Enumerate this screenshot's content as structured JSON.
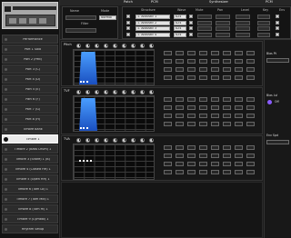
{
  "sidebar": {
    "items": [
      {
        "label": "Performance",
        "selected": false
      },
      {
        "label": "Part 1 Solo",
        "selected": false
      },
      {
        "label": "Part 2 (Ped)",
        "selected": false
      },
      {
        "label": "Part 3 (C)",
        "selected": false
      },
      {
        "label": "Part 4 (D)",
        "selected": false
      },
      {
        "label": "Part 5 (E)",
        "selected": false
      },
      {
        "label": "Part 6 (F)",
        "selected": false
      },
      {
        "label": "Part 7 (G)",
        "selected": false
      },
      {
        "label": "Part 8 (H)",
        "selected": false
      },
      {
        "label": "Timbre Bank",
        "selected": false
      },
      {
        "label": "Timbre 1",
        "selected": true
      },
      {
        "label": "Timbre 2 (Bass Drum) 1",
        "selected": false
      },
      {
        "label": "Timbre 3 (Snare) 1 (B)",
        "selected": false
      },
      {
        "label": "Timbre 4 (Closed HH) 1",
        "selected": false
      },
      {
        "label": "Timbre 5 (Open HH) 1",
        "selected": false
      },
      {
        "label": "Timbre 6 (Tom Lo) 1",
        "selected": false
      },
      {
        "label": "Timbre 7 (Tom Mid) 1",
        "selected": false
      },
      {
        "label": "Timbre 8 (Tom Hi) 1",
        "selected": false
      },
      {
        "label": "Timbre 9 (Cymbal) 1",
        "selected": false
      },
      {
        "label": "Rhythm Setup",
        "selected": false
      }
    ]
  },
  "header": {
    "tabs": [
      "PCM",
      "Synthesizer",
      "PCM"
    ],
    "left_tabs": [
      "Patch"
    ],
    "name_label": "Name",
    "mode_label": "Mode",
    "mode_value": "Normal",
    "filter_label": "Filter",
    "structure_label": "Structure",
    "cols": [
      "Wave",
      "Mute",
      "Pan",
      "Level",
      "Key",
      "Env"
    ],
    "wave_rows": [
      "1. Acoustic 1",
      "1. Acoustic 2",
      "1. Acoustic 3",
      "1. Acoustic 4"
    ],
    "num_rows": [
      "024",
      "024",
      "024",
      "024"
    ]
  },
  "panels": [
    {
      "name": "Pitch"
    },
    {
      "name": "TVF"
    },
    {
      "name": "TVA"
    }
  ],
  "right_col": {
    "label_a": "Bias Pt",
    "label_b": "Bias Lvl",
    "label_c": "Env Spd",
    "value_a": "Off"
  },
  "colors": {
    "envelope_top": "#4a9eff",
    "envelope_bottom": "#1a4fc0",
    "accent": "#8a5cff"
  }
}
